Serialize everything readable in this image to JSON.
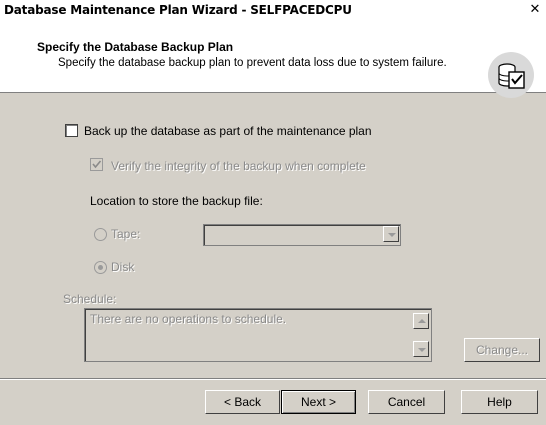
{
  "window": {
    "title": "Database Maintenance Plan Wizard - SELFPACEDCPU",
    "close_glyph": "✕"
  },
  "header": {
    "title": "Specify the Database Backup Plan",
    "subtitle": "Specify the database backup plan to prevent data loss due to system failure.",
    "icon": "database-checklist-icon"
  },
  "backup": {
    "checkbox_label": "Back up the database as part of the maintenance plan",
    "checked": false,
    "verify_label": "Verify the integrity of the backup when complete",
    "verify_checked": true,
    "location_label": "Location to store the backup file:",
    "tape_label": "Tape:",
    "tape_selected": false,
    "tape_value": "",
    "disk_label": "Disk",
    "disk_selected": true
  },
  "schedule": {
    "label": "Schedule:",
    "text": "There are no operations to schedule.",
    "change_label": "Change..."
  },
  "buttons": {
    "back": "< Back",
    "next": "Next >",
    "cancel": "Cancel",
    "help": "Help"
  },
  "colors": {
    "dialog_bg": "#d4d0c8",
    "header_bg": "#ffffff",
    "disabled_text": "#8a8a8a"
  }
}
